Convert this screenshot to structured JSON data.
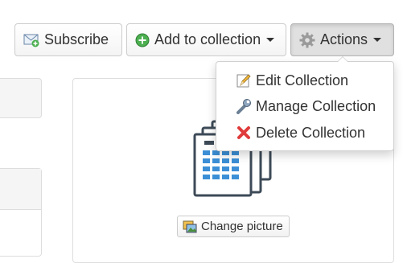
{
  "toolbar": {
    "subscribe": {
      "label": "Subscribe",
      "icon": "envelope-plus-icon"
    },
    "add_to_collection": {
      "label": "Add to collection",
      "icon": "green-plus-circle-icon"
    },
    "actions": {
      "label": "Actions",
      "icon": "gear-icon"
    }
  },
  "actions_menu": {
    "items": [
      {
        "label": "Edit Collection",
        "icon": "pencil-edit-icon"
      },
      {
        "label": "Manage Collection",
        "icon": "wrench-icon"
      },
      {
        "label": "Delete Collection",
        "icon": "red-x-delete-icon"
      }
    ]
  },
  "collection_card": {
    "image_icon": "building-stack-icon",
    "change_picture": {
      "label": "Change picture",
      "icon": "pictures-icon"
    }
  },
  "colors": {
    "accent_blue": "#3c8fd6",
    "delete_red": "#e03b3b",
    "add_green": "#4caf50",
    "dark_outline": "#3d4a57"
  }
}
